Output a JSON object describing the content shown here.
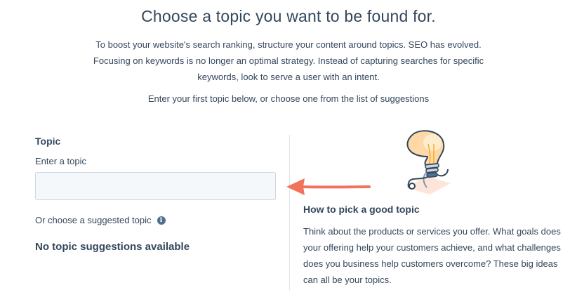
{
  "header": {
    "title": "Choose a topic you want to be found for."
  },
  "intro": {
    "text": "To boost your website's search ranking, structure your content around topics. SEO has evolved. Focusing on keywords is no longer an optimal strategy. Instead of capturing searches for specific keywords, look to serve a user with an intent."
  },
  "instruction": {
    "text": "Enter your first topic below, or choose one from the list of suggestions"
  },
  "topic_form": {
    "heading": "Topic",
    "input_label": "Enter a topic",
    "input_value": "",
    "input_placeholder": "",
    "suggested_label": "Or choose a suggested topic",
    "info_icon": "info-icon",
    "no_suggestions": "No topic suggestions available"
  },
  "help_panel": {
    "illustration": "lightbulb-icon",
    "arrow_icon": "arrow-left-icon",
    "arrow_color": "#f2735c",
    "title": "How to pick a good topic",
    "body": "Think about the products or services you offer. What goals does your offering help your customers achieve, and what challenges does you business help customers overcome? These big ideas can all be your topics."
  },
  "colors": {
    "text": "#33475b",
    "input_background": "#f5f8fa",
    "input_border": "#cbd6e2",
    "divider": "#dfe3eb",
    "accent": "#f2735c"
  }
}
